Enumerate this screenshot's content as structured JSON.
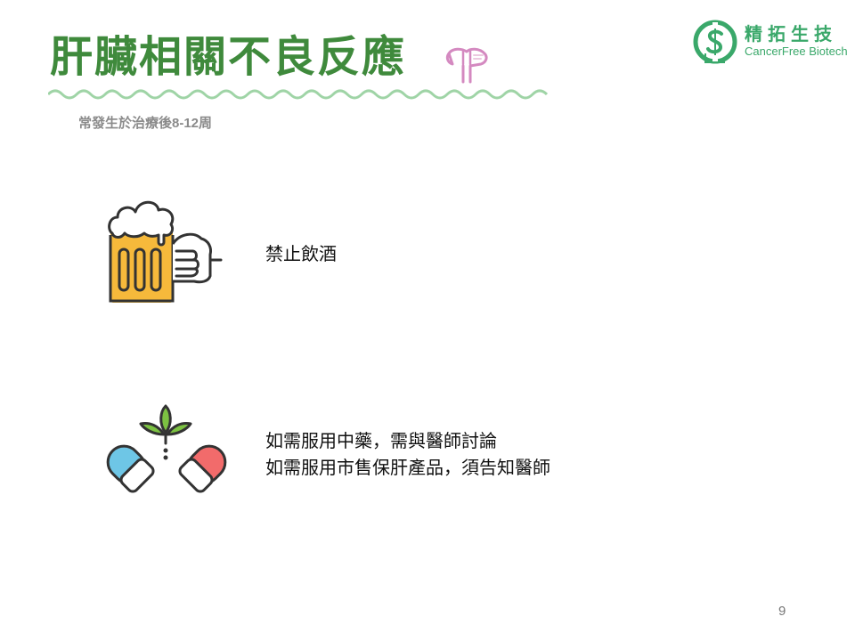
{
  "slide": {
    "title": "肝臟相關不良反應",
    "subtitle": "常發生於治療後8-12周",
    "page_number": "9"
  },
  "logo": {
    "name_cn": "精拓生技",
    "name_en": "CancerFree Biotech"
  },
  "items": [
    {
      "icon": "beer-fist-icon",
      "lines": [
        "禁止飲酒"
      ]
    },
    {
      "icon": "herb-capsule-icon",
      "lines": [
        "如需服用中藥，需與醫師討論",
        "如需服用市售保肝產品，須告知醫師"
      ]
    }
  ],
  "colors": {
    "title": "#3f8a3c",
    "wave": "#9fd4a6",
    "logo": "#3aa86a",
    "beer": "#f6b93b",
    "capsule_blue": "#6ec6e6",
    "capsule_red": "#f26b6b",
    "leaf": "#7cc242"
  }
}
